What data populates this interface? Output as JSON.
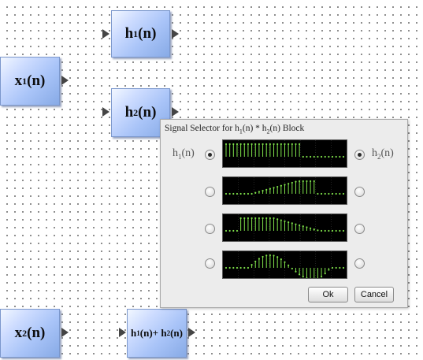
{
  "blocks": {
    "h1": {
      "base": "h",
      "sub": "1",
      "suffix": "(n)"
    },
    "x1": {
      "base": "x",
      "sub": "1",
      "suffix": "(n)"
    },
    "h2": {
      "base": "h",
      "sub": "2",
      "suffix": "(n)"
    },
    "x2": {
      "base": "x",
      "sub": "2",
      "suffix": "(n)"
    },
    "sum": {
      "a": "h",
      "a_sub": "1",
      "mid": "(n)+ h",
      "b_sub": "2",
      "end": "(n)"
    }
  },
  "dialog": {
    "title_pre": "Signal Selector for h",
    "title_sub1": "1",
    "title_mid": "(n) * h",
    "title_sub2": "2",
    "title_post": "(n) Block",
    "left_label": {
      "base": "h",
      "sub": "1",
      "suffix": "(n)"
    },
    "right_label": {
      "base": "h",
      "sub": "2",
      "suffix": "(n)"
    },
    "selected_left": 0,
    "selected_right": 0,
    "ok_label": "Ok",
    "cancel_label": "Cancel"
  },
  "colors": {
    "stem": "#7ee04a",
    "grid": "#3a3a3a",
    "plot_bg": "#000000"
  },
  "signals": [
    [
      1,
      1,
      1,
      1,
      1,
      1,
      1,
      1,
      1,
      1,
      1,
      1,
      1,
      1,
      1,
      1,
      1,
      1,
      1,
      1,
      1,
      0,
      0,
      0,
      0,
      0,
      0,
      0,
      0,
      0,
      0,
      0,
      0
    ],
    [
      0,
      0,
      0,
      0,
      0,
      0,
      0,
      0,
      0.08,
      0.16,
      0.24,
      0.32,
      0.4,
      0.48,
      0.56,
      0.64,
      0.72,
      0.8,
      0.88,
      0.96,
      1,
      1,
      1,
      1,
      1,
      0,
      0,
      0,
      0,
      0,
      0,
      0,
      0
    ],
    [
      0,
      0,
      0,
      0,
      1,
      1,
      1,
      1,
      1,
      1,
      1,
      1,
      1,
      1,
      0.92,
      0.84,
      0.76,
      0.68,
      0.6,
      0.52,
      0.44,
      0.36,
      0.28,
      0.2,
      0.12,
      0.04,
      0,
      0,
      0,
      0,
      0,
      0,
      0
    ],
    [
      0,
      0,
      0,
      0,
      0,
      0,
      0,
      0.24,
      0.5,
      0.72,
      0.88,
      0.98,
      1,
      0.97,
      0.86,
      0.68,
      0.45,
      0.2,
      -0.06,
      -0.3,
      -0.52,
      -0.7,
      -0.82,
      -0.9,
      -0.92,
      -0.86,
      -0.7,
      -0.45,
      -0.16,
      0,
      0,
      0,
      0
    ]
  ]
}
